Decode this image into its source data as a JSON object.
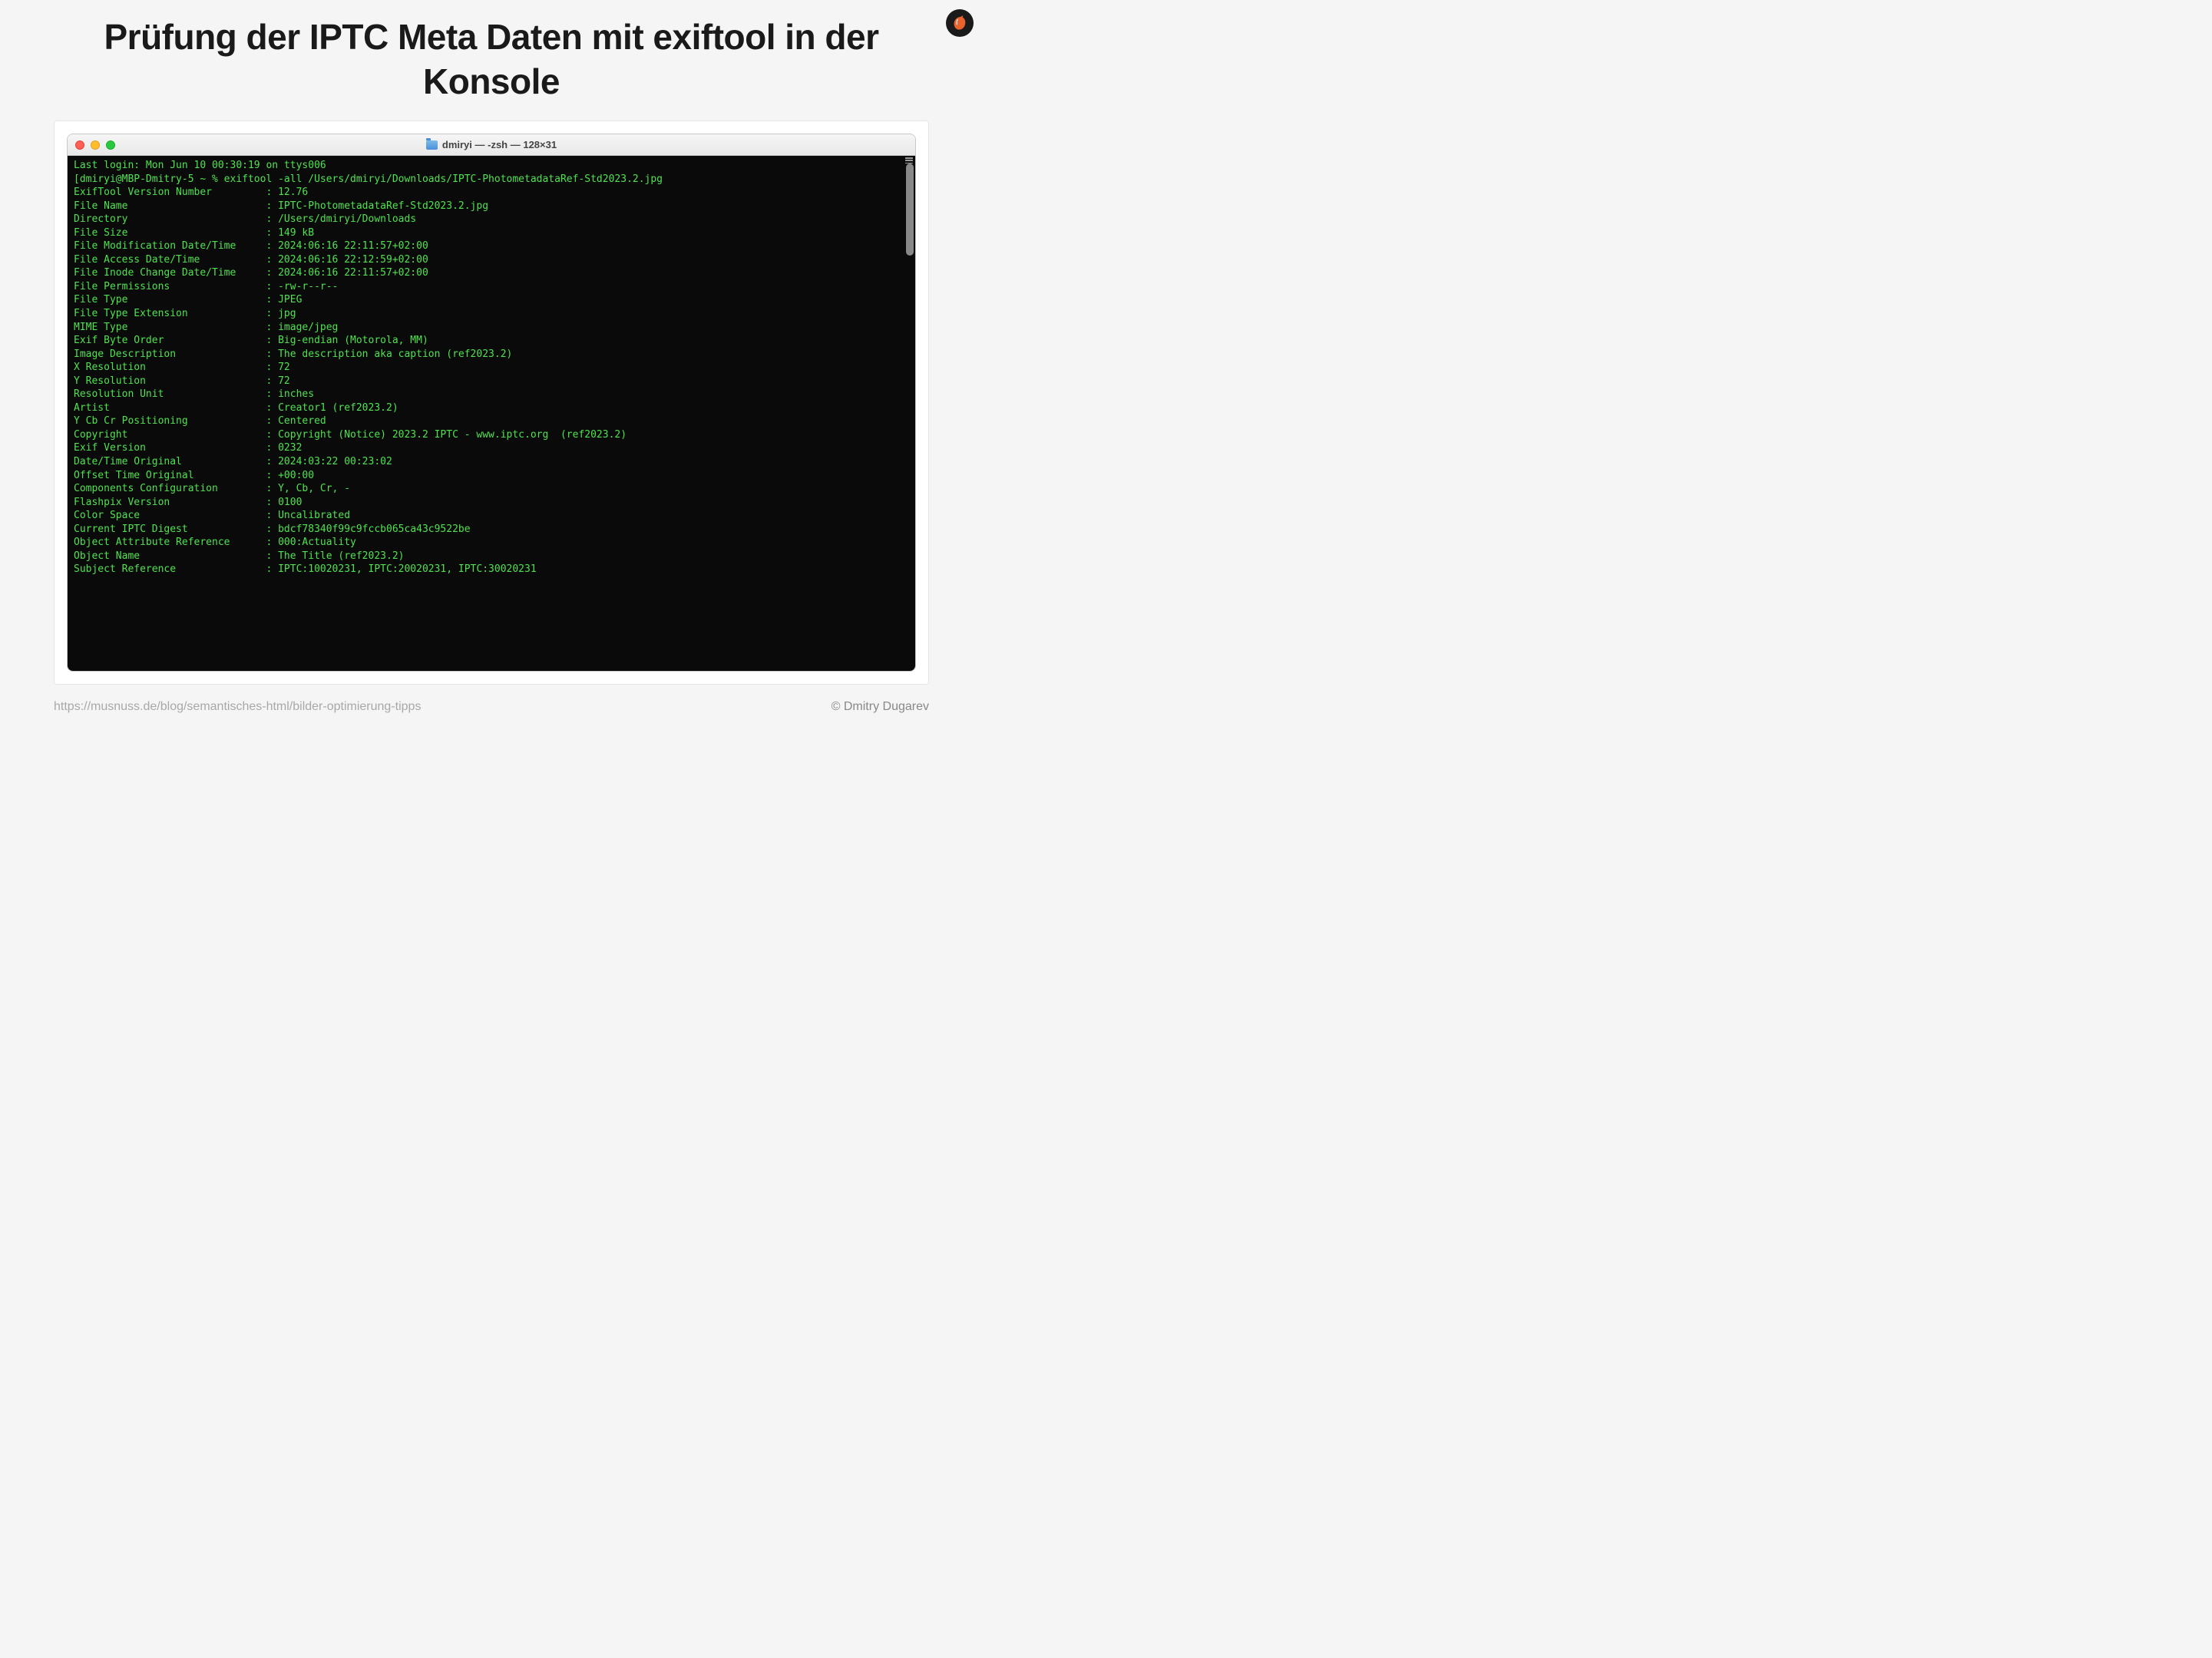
{
  "title": "Prüfung der IPTC Meta Daten mit exiftool in der Konsole",
  "window_title": "dmiryi — -zsh — 128×31",
  "login_line": "Last login: Mon Jun 10 00:30:19 on ttys006",
  "prompt_line": "[dmiryi@MBP-Dmitry-5 ~ % exiftool -all /Users/dmiryi/Downloads/IPTC-PhotometadataRef-Std2023.2.jpg",
  "rows": [
    {
      "k": "ExifTool Version Number",
      "v": "12.76"
    },
    {
      "k": "File Name",
      "v": "IPTC-PhotometadataRef-Std2023.2.jpg"
    },
    {
      "k": "Directory",
      "v": "/Users/dmiryi/Downloads"
    },
    {
      "k": "File Size",
      "v": "149 kB"
    },
    {
      "k": "File Modification Date/Time",
      "v": "2024:06:16 22:11:57+02:00"
    },
    {
      "k": "File Access Date/Time",
      "v": "2024:06:16 22:12:59+02:00"
    },
    {
      "k": "File Inode Change Date/Time",
      "v": "2024:06:16 22:11:57+02:00"
    },
    {
      "k": "File Permissions",
      "v": "-rw-r--r--"
    },
    {
      "k": "File Type",
      "v": "JPEG"
    },
    {
      "k": "File Type Extension",
      "v": "jpg"
    },
    {
      "k": "MIME Type",
      "v": "image/jpeg"
    },
    {
      "k": "Exif Byte Order",
      "v": "Big-endian (Motorola, MM)"
    },
    {
      "k": "Image Description",
      "v": "The description aka caption (ref2023.2)"
    },
    {
      "k": "X Resolution",
      "v": "72"
    },
    {
      "k": "Y Resolution",
      "v": "72"
    },
    {
      "k": "Resolution Unit",
      "v": "inches"
    },
    {
      "k": "Artist",
      "v": "Creator1 (ref2023.2)"
    },
    {
      "k": "Y Cb Cr Positioning",
      "v": "Centered"
    },
    {
      "k": "Copyright",
      "v": "Copyright (Notice) 2023.2 IPTC - www.iptc.org  (ref2023.2)"
    },
    {
      "k": "Exif Version",
      "v": "0232"
    },
    {
      "k": "Date/Time Original",
      "v": "2024:03:22 00:23:02"
    },
    {
      "k": "Offset Time Original",
      "v": "+00:00"
    },
    {
      "k": "Components Configuration",
      "v": "Y, Cb, Cr, -"
    },
    {
      "k": "Flashpix Version",
      "v": "0100"
    },
    {
      "k": "Color Space",
      "v": "Uncalibrated"
    },
    {
      "k": "Current IPTC Digest",
      "v": "bdcf78340f99c9fccb065ca43c9522be"
    },
    {
      "k": "Object Attribute Reference",
      "v": "000:Actuality"
    },
    {
      "k": "Object Name",
      "v": "The Title (ref2023.2)"
    },
    {
      "k": "Subject Reference",
      "v": "IPTC:10020231, IPTC:20020231, IPTC:30020231"
    }
  ],
  "footer_url": "https://musnuss.de/blog/semantisches-html/bilder-optimierung-tipps",
  "footer_credit": "© Dmitry Dugarev"
}
